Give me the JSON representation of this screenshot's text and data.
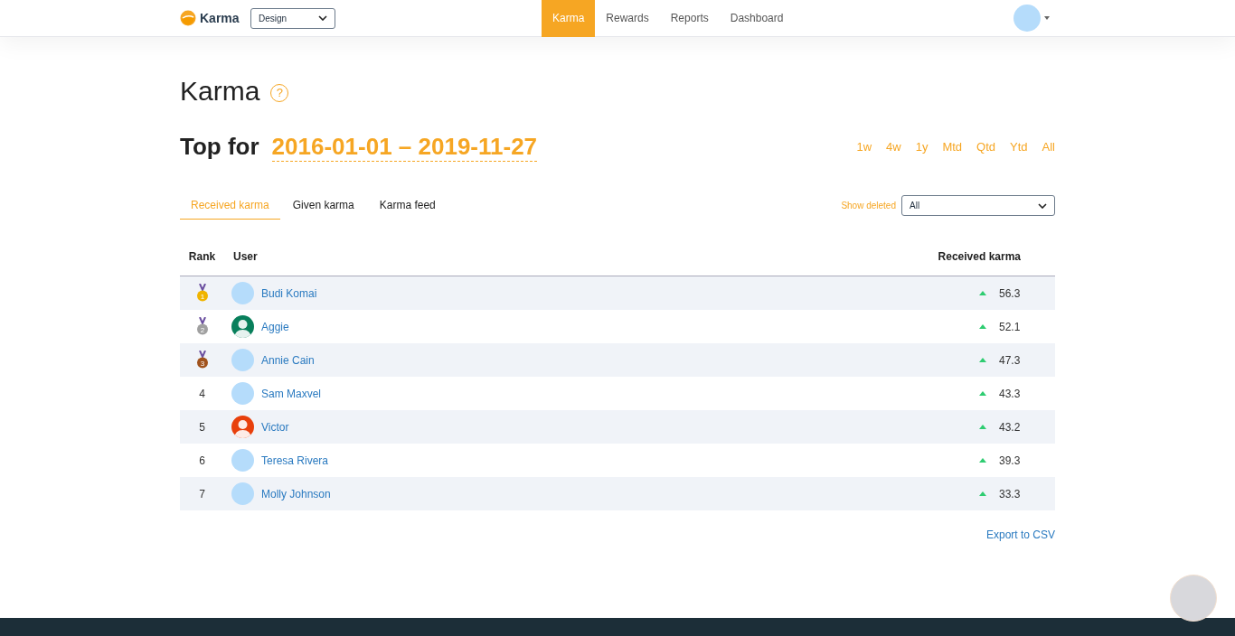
{
  "nav": {
    "brand": "Karma",
    "team_select": "Design",
    "links": [
      {
        "label": "Karma",
        "selected": true
      },
      {
        "label": "Rewards",
        "selected": false
      },
      {
        "label": "Reports",
        "selected": false
      },
      {
        "label": "Dashboard",
        "selected": false
      }
    ]
  },
  "page": {
    "title": "Karma",
    "help_icon": "?",
    "top_for": "Top for",
    "date_range": "2016-01-01 – 2019-11-27",
    "periods": [
      "1w",
      "4w",
      "1y",
      "Mtd",
      "Qtd",
      "Ytd",
      "All"
    ]
  },
  "tabs": [
    {
      "label": "Received karma",
      "selected": true
    },
    {
      "label": "Given karma",
      "selected": false
    },
    {
      "label": "Karma feed",
      "selected": false
    }
  ],
  "filter": {
    "label": "Show deleted",
    "value": "All"
  },
  "table": {
    "columns": [
      "Rank",
      "User",
      "Received karma"
    ],
    "rows": [
      {
        "rank": {
          "kind": "medal",
          "label": "1",
          "color": "#f0b400"
        },
        "user": "Budi Komai",
        "avatar": {
          "kind": "cartoon"
        },
        "karma": "56.3"
      },
      {
        "rank": {
          "kind": "medal",
          "label": "2",
          "color": "#a0a0a0"
        },
        "user": "Aggie",
        "avatar": {
          "kind": "silhouette",
          "color": "#087f5b"
        },
        "karma": "52.1"
      },
      {
        "rank": {
          "kind": "medal",
          "label": "3",
          "color": "#a0521d"
        },
        "user": "Annie Cain",
        "avatar": {
          "kind": "cartoon"
        },
        "karma": "47.3"
      },
      {
        "rank": {
          "kind": "number",
          "label": "4"
        },
        "user": "Sam Maxvel",
        "avatar": {
          "kind": "cartoon"
        },
        "karma": "43.3"
      },
      {
        "rank": {
          "kind": "number",
          "label": "5"
        },
        "user": "Victor",
        "avatar": {
          "kind": "silhouette",
          "color": "#e8400c"
        },
        "karma": "43.2"
      },
      {
        "rank": {
          "kind": "number",
          "label": "6"
        },
        "user": "Teresa Rivera",
        "avatar": {
          "kind": "cartoon"
        },
        "karma": "39.3"
      },
      {
        "rank": {
          "kind": "number",
          "label": "7"
        },
        "user": "Molly Johnson",
        "avatar": {
          "kind": "cartoon"
        },
        "karma": "33.3"
      }
    ]
  },
  "export_link": "Export to CSV"
}
